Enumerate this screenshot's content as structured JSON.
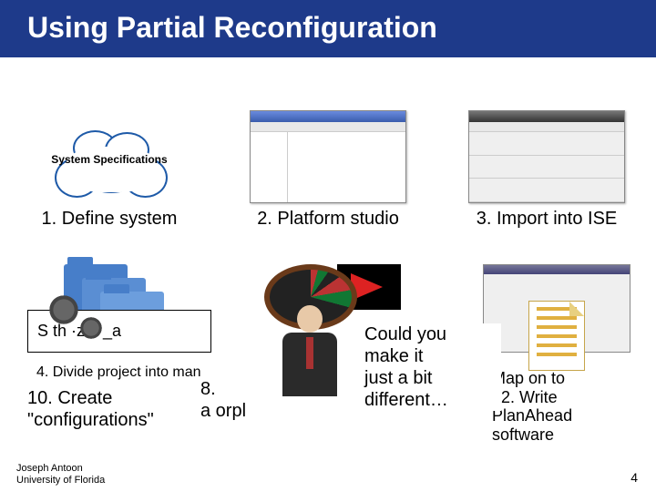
{
  "title": "Using Partial Reconfiguration",
  "row1": {
    "cloud_label": "System Specifications",
    "c1": "1. Define system",
    "c2": "2. Platform studio",
    "c3": "3. Import into ISE"
  },
  "mess": {
    "synth_box": "S   th   ·ze!      _a",
    "divide": "4. Divide project into man",
    "ten": "10. Create\n\"configurations\"",
    "eight": "8.\na              orpl",
    "bubble": "Could you\nmake it\njust a bit\ndifferent…",
    "right": "Map on to\n12. Write\nPlanAhead\nsoftware"
  },
  "footer": {
    "name": "Joseph Antoon",
    "affil": "University of Florida"
  },
  "slidenum": "4"
}
